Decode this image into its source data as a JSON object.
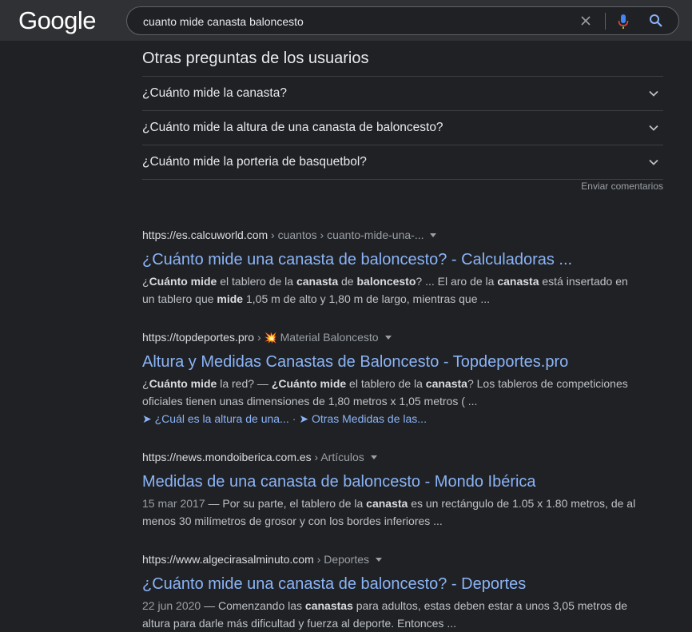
{
  "header": {
    "logo": "Google",
    "query": "cuanto mide canasta baloncesto"
  },
  "paa": {
    "title": "Otras preguntas de los usuarios",
    "questions": [
      "¿Cuánto mide la canasta?",
      "¿Cuánto mide la altura de una canasta de baloncesto?",
      "¿Cuánto mide la porteria de basquetbol?"
    ],
    "feedback": "Enviar comentarios"
  },
  "results": [
    {
      "domain": "https://es.calcuworld.com",
      "path": " › cuantos › cuanto-mide-una-...",
      "title": "¿Cuánto mide una canasta de baloncesto? - Calculadoras ...",
      "snippet": [
        {
          "t": "¿"
        },
        {
          "b": "Cuánto mide"
        },
        {
          "t": " el tablero de la "
        },
        {
          "b": "canasta"
        },
        {
          "t": " de "
        },
        {
          "b": "baloncesto"
        },
        {
          "t": "? ... El aro de la "
        },
        {
          "b": "canasta"
        },
        {
          "t": " está insertado en un tablero que "
        },
        {
          "b": "mide"
        },
        {
          "t": " 1,05 m de alto y 1,80 m de largo, mientras que ..."
        }
      ]
    },
    {
      "domain": "https://topdeportes.pro",
      "path_prefix": " › ",
      "emoji": "💥",
      "path": " Material Baloncesto",
      "title": "Altura y Medidas Canastas de Baloncesto - Topdeportes.pro",
      "snippet": [
        {
          "t": "¿"
        },
        {
          "b": "Cuánto mide"
        },
        {
          "t": " la red? — "
        },
        {
          "b": "¿Cuánto mide"
        },
        {
          "t": " el tablero de la "
        },
        {
          "b": "canasta"
        },
        {
          "t": "? Los tableros de competiciones oficiales tienen unas dimensiones de 1,80 metros x 1,05 metros ( ..."
        }
      ],
      "sitelinks": [
        "➤ ¿Cuál es la altura de una...",
        "➤ Otras Medidas de las..."
      ]
    },
    {
      "domain": "https://news.mondoiberica.com.es",
      "path": " › Artículos",
      "title": "Medidas de una canasta de baloncesto - Mondo Ibérica",
      "date": "15 mar 2017",
      "snippet": [
        {
          "t": " — Por su parte, el tablero de la "
        },
        {
          "b": "canasta"
        },
        {
          "t": " es un rectángulo de 1.05 x 1.80 metros, de al menos 30 milímetros de grosor y con los bordes inferiores ..."
        }
      ]
    },
    {
      "domain": "https://www.algecirasalminuto.com",
      "path": " › Deportes",
      "title": "¿Cuánto mide una canasta de baloncesto? - Deportes",
      "date": "22 jun 2020",
      "snippet": [
        {
          "t": " — Comenzando las "
        },
        {
          "b": "canastas"
        },
        {
          "t": " para adultos, estas deben estar a unos 3,05 metros de altura para darle más dificultad y fuerza al deporte. Entonces ..."
        }
      ]
    }
  ],
  "colors": {
    "background": "#202124",
    "header": "#303134",
    "link": "#8ab4f8",
    "text": "#bdc1c6"
  }
}
